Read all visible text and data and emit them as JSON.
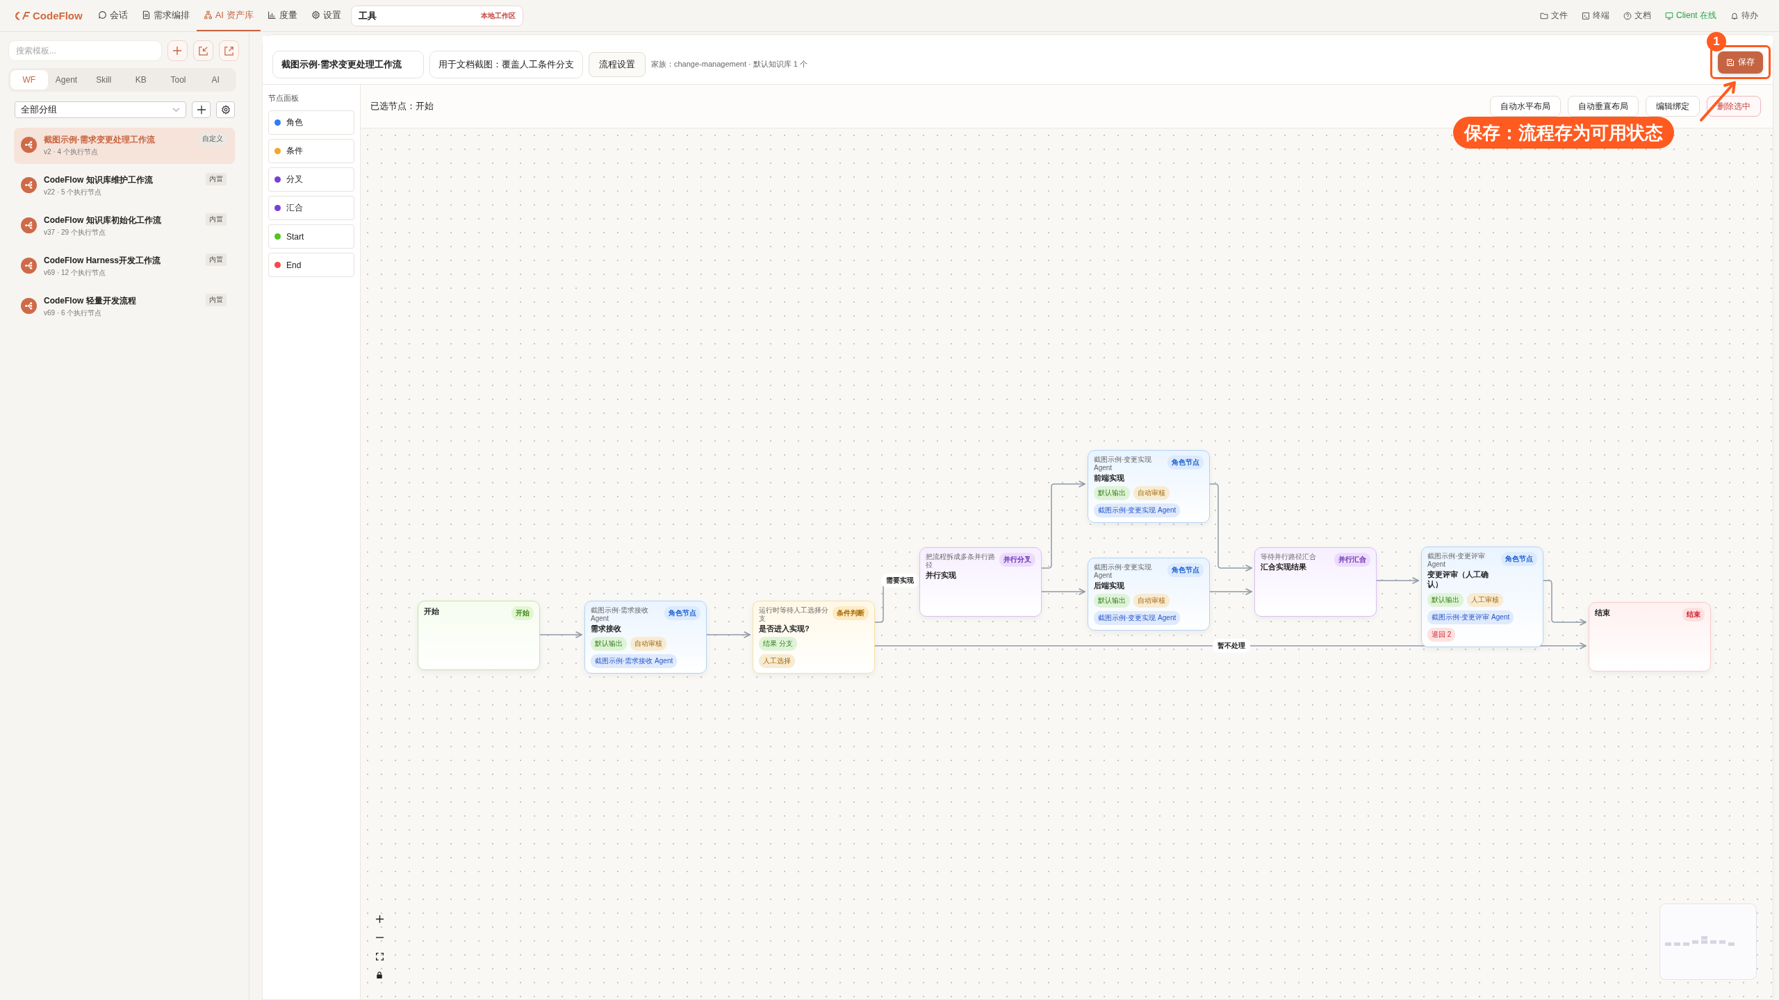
{
  "app": {
    "logo": "CodeFlow"
  },
  "nav": [
    {
      "label": "会话",
      "selected": false
    },
    {
      "label": "需求编排",
      "selected": false
    },
    {
      "label": "AI 资产库",
      "selected": true
    },
    {
      "label": "度量",
      "selected": false
    },
    {
      "label": "设置",
      "selected": false
    }
  ],
  "workspace": {
    "value": "工具",
    "badge": "本地工作区"
  },
  "right_nav": [
    {
      "label": "文件",
      "online": false
    },
    {
      "label": "终端",
      "online": false
    },
    {
      "label": "文档",
      "online": false
    },
    {
      "label": "Client 在线",
      "online": true
    },
    {
      "label": "待办",
      "online": false
    }
  ],
  "sidebar": {
    "search": {
      "placeholder": "搜索模板..."
    },
    "tabs": [
      {
        "label": "WF",
        "selected": true
      },
      {
        "label": "Agent",
        "selected": false
      },
      {
        "label": "Skill",
        "selected": false
      },
      {
        "label": "KB",
        "selected": false
      },
      {
        "label": "Tool",
        "selected": false
      },
      {
        "label": "AI",
        "selected": false
      }
    ],
    "group_select": {
      "value": "全部分组"
    },
    "items": [
      {
        "title": "截图示例·需求变更处理工作流",
        "meta": "v2 · 4 个执行节点",
        "badge": "自定义",
        "selected": true
      },
      {
        "title": "CodeFlow 知识库维护工作流",
        "meta": "v22 · 5 个执行节点",
        "badge": "内置",
        "selected": false
      },
      {
        "title": "CodeFlow 知识库初始化工作流",
        "meta": "v37 · 29 个执行节点",
        "badge": "内置",
        "selected": false
      },
      {
        "title": "CodeFlow Harness开发工作流",
        "meta": "v69 · 12 个执行节点",
        "badge": "内置",
        "selected": false
      },
      {
        "title": "CodeFlow 轻量开发流程",
        "meta": "v69 · 6 个执行节点",
        "badge": "内置",
        "selected": false
      }
    ]
  },
  "editor": {
    "name_field": {
      "value": "截图示例·需求变更处理工作流"
    },
    "desc_field": {
      "value": "用于文档截图：覆盖人工条件分支"
    },
    "settings_button": "流程设置",
    "family_info": "家族：change-management · 默认知识库 1 个",
    "save_button": "保存"
  },
  "palette": {
    "title": "节点面板",
    "items": [
      {
        "label": "角色",
        "color": "#2f7cf6"
      },
      {
        "label": "条件",
        "color": "#f5a623"
      },
      {
        "label": "分叉",
        "color": "#7a3ed6"
      },
      {
        "label": "汇合",
        "color": "#7a3ed6"
      },
      {
        "label": "Start",
        "color": "#52c41a"
      },
      {
        "label": "End",
        "color": "#f5484f"
      }
    ]
  },
  "toolbar": {
    "selection": "已选节点：开始",
    "buttons": [
      {
        "label": "自动水平布局",
        "kind": "normal"
      },
      {
        "label": "自动垂直布局",
        "kind": "normal"
      },
      {
        "label": "编辑绑定",
        "kind": "normal"
      },
      {
        "label": "删除选中",
        "kind": "danger"
      }
    ]
  },
  "canvas": {
    "nodes": [
      {
        "kind": "start",
        "title": "开始",
        "badge": "开始"
      },
      {
        "kind": "role",
        "subtitle": "截图示例·需求接收 Agent",
        "title": "需求接收",
        "badge": "角色节点",
        "tag_rows": [
          [
            {
              "text": "默认输出",
              "kind": "output"
            },
            {
              "text": "自动审核",
              "kind": "review"
            }
          ],
          [
            {
              "text": "截图示例·需求接收 Agent",
              "kind": "agent"
            }
          ]
        ]
      },
      {
        "kind": "condition",
        "subtitle": "运行时等待人工选择分支",
        "title": "是否进入实现?",
        "badge": "条件判断",
        "tag_rows": [
          [
            {
              "text": "结果 分支",
              "kind": "output"
            }
          ],
          [
            {
              "text": "人工选择",
              "kind": "review"
            }
          ]
        ]
      },
      {
        "kind": "fork",
        "subtitle": "把流程拆成多条并行路径",
        "title": "并行实现",
        "badge": "并行分叉"
      },
      {
        "kind": "role",
        "subtitle": "截图示例·变更实现 Agent",
        "title": "前端实现",
        "badge": "角色节点",
        "tag_rows": [
          [
            {
              "text": "默认输出",
              "kind": "output"
            },
            {
              "text": "自动审核",
              "kind": "review"
            }
          ],
          [
            {
              "text": "截图示例·变更实现 Agent",
              "kind": "agent"
            }
          ]
        ]
      },
      {
        "kind": "role",
        "subtitle": "截图示例·变更实现 Agent",
        "title": "后端实现",
        "badge": "角色节点",
        "tag_rows": [
          [
            {
              "text": "默认输出",
              "kind": "output"
            },
            {
              "text": "自动审核",
              "kind": "review"
            }
          ],
          [
            {
              "text": "截图示例·变更实现 Agent",
              "kind": "agent"
            }
          ]
        ]
      },
      {
        "kind": "join",
        "subtitle": "等待并行路径汇合",
        "title": "汇合实现结果",
        "badge": "并行汇合"
      },
      {
        "kind": "role",
        "subtitle": "截图示例·变更评审 Agent",
        "title": "变更评审（人工确认）",
        "badge": "角色节点",
        "tag_rows": [
          [
            {
              "text": "默认输出",
              "kind": "output"
            },
            {
              "text": "人工审核",
              "kind": "review"
            }
          ],
          [
            {
              "text": "截图示例·变更评审 Agent",
              "kind": "agent"
            },
            {
              "text": "退回 2",
              "kind": "retry"
            }
          ]
        ]
      },
      {
        "kind": "end",
        "title": "结束",
        "badge": "结束"
      }
    ],
    "edge_labels": [
      {
        "text": "需要实现"
      },
      {
        "text": "暂不处理"
      }
    ]
  },
  "annotation": {
    "number": "1",
    "text": "保存：流程存为可用状态"
  }
}
